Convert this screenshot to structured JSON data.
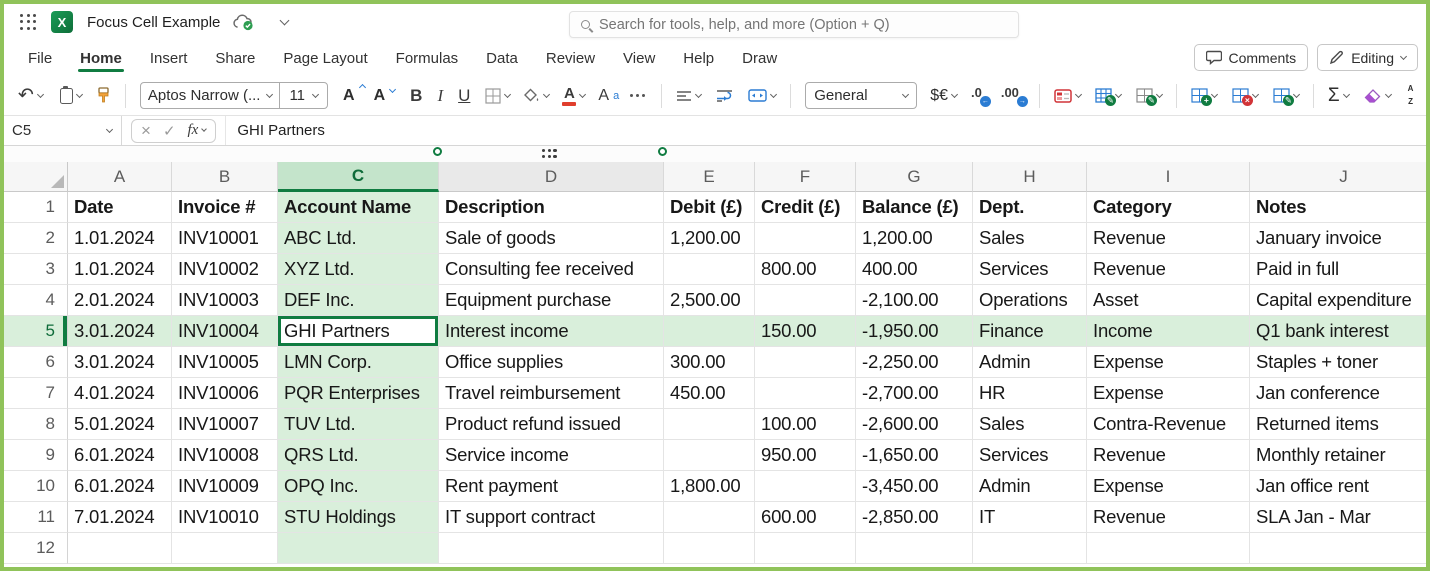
{
  "titlebar": {
    "title": "Focus Cell Example",
    "search_placeholder": "Search for tools, help, and more (Option + Q)"
  },
  "menubar": {
    "items": [
      "File",
      "Home",
      "Insert",
      "Share",
      "Page Layout",
      "Formulas",
      "Data",
      "Review",
      "View",
      "Help",
      "Draw"
    ],
    "active_item": "Home",
    "comments_label": "Comments",
    "editing_label": "Editing"
  },
  "ribbon": {
    "undo": "↶",
    "font_name": "Aptos Narrow (...",
    "font_size": "11",
    "grow_font": "A",
    "shrink_font": "A",
    "bold": "B",
    "italic": "I",
    "underline": "U",
    "font_color_letter": "A",
    "char_format_letter": "A",
    "char_format_sup": "a",
    "number_format": "General",
    "currency": "$€",
    "decrease_decimal": ".0",
    "increase_decimal": ".00",
    "autosum": "Σ",
    "sort_a": "A",
    "sort_z": "Z"
  },
  "formula_bar": {
    "name_box": "C5",
    "cancel": "×",
    "enter": "✓",
    "fx": "fx",
    "content": "GHI Partners"
  },
  "sheet": {
    "column_letters": [
      "A",
      "B",
      "C",
      "D",
      "E",
      "F",
      "G",
      "H",
      "I",
      "J"
    ],
    "focus": {
      "cell": "C5",
      "column": "C",
      "row": 5
    },
    "header_row": [
      "Date",
      "Invoice #",
      "Account Name",
      "Description",
      "Debit (£)",
      "Credit (£)",
      "Balance (£)",
      "Dept.",
      "Category",
      "Notes"
    ],
    "rows": [
      {
        "n": 2,
        "cells": [
          "1.01.2024",
          "INV10001",
          "ABC Ltd.",
          "Sale of goods",
          "1,200.00",
          "",
          "1,200.00",
          "Sales",
          "Revenue",
          "January invoice"
        ]
      },
      {
        "n": 3,
        "cells": [
          "1.01.2024",
          "INV10002",
          "XYZ Ltd.",
          "Consulting fee received",
          "",
          "800.00",
          "400.00",
          "Services",
          "Revenue",
          "Paid in full"
        ]
      },
      {
        "n": 4,
        "cells": [
          "2.01.2024",
          "INV10003",
          "DEF Inc.",
          "Equipment purchase",
          "2,500.00",
          "",
          "-2,100.00",
          "Operations",
          "Asset",
          "Capital expenditure"
        ]
      },
      {
        "n": 5,
        "cells": [
          "3.01.2024",
          "INV10004",
          "GHI Partners",
          "Interest income",
          "",
          "150.00",
          "-1,950.00",
          "Finance",
          "Income",
          "Q1 bank interest"
        ]
      },
      {
        "n": 6,
        "cells": [
          "3.01.2024",
          "INV10005",
          "LMN Corp.",
          "Office supplies",
          "300.00",
          "",
          "-2,250.00",
          "Admin",
          "Expense",
          "Staples + toner"
        ]
      },
      {
        "n": 7,
        "cells": [
          "4.01.2024",
          "INV10006",
          "PQR Enterprises",
          "Travel reimbursement",
          "450.00",
          "",
          "-2,700.00",
          "HR",
          "Expense",
          "Jan conference"
        ]
      },
      {
        "n": 8,
        "cells": [
          "5.01.2024",
          "INV10007",
          "TUV Ltd.",
          "Product refund issued",
          "",
          "100.00",
          "-2,600.00",
          "Sales",
          "Contra-Revenue",
          "Returned items"
        ]
      },
      {
        "n": 9,
        "cells": [
          "6.01.2024",
          "INV10008",
          "QRS Ltd.",
          "Service income",
          "",
          "950.00",
          "-1,650.00",
          "Services",
          "Revenue",
          "Monthly retainer"
        ]
      },
      {
        "n": 10,
        "cells": [
          "6.01.2024",
          "INV10009",
          "OPQ Inc.",
          "Rent payment",
          "1,800.00",
          "",
          "-3,450.00",
          "Admin",
          "Expense",
          "Jan office rent"
        ]
      },
      {
        "n": 11,
        "cells": [
          "7.01.2024",
          "INV10010",
          "STU Holdings",
          "IT support contract",
          "",
          "600.00",
          "-2,850.00",
          "IT",
          "Revenue",
          "SLA Jan - Mar"
        ]
      },
      {
        "n": 12,
        "cells": [
          "",
          "",
          "",
          "",
          "",
          "",
          "",
          "",
          "",
          ""
        ]
      }
    ]
  },
  "colors": {
    "frame_green": "#90c35a",
    "excel_green": "#107C41",
    "focus_tint": "#d9efdb",
    "focus_header_tint": "#c4e4cb",
    "accent_blue": "#2b7cd3",
    "accent_red": "#d13438"
  }
}
